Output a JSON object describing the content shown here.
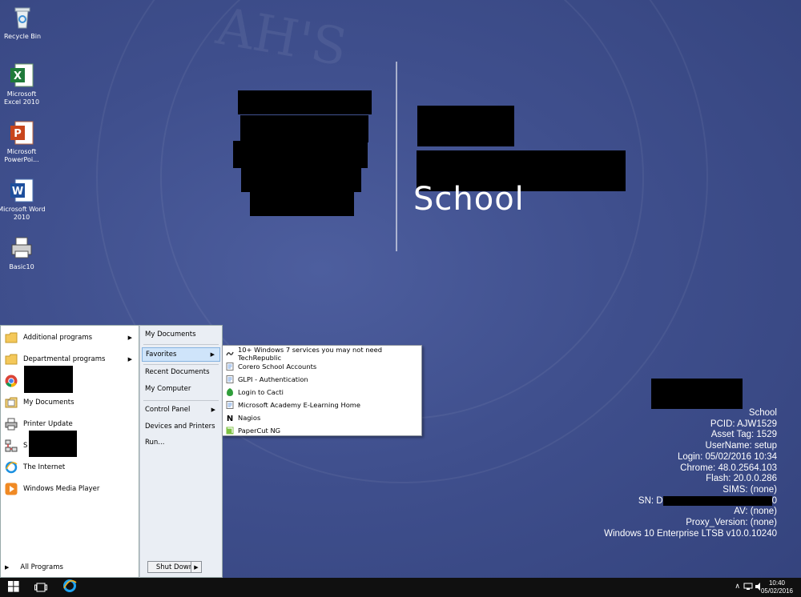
{
  "desktop": {
    "icons": [
      {
        "label": "Recycle Bin"
      },
      {
        "label": "Microsoft Excel 2010"
      },
      {
        "label": "Microsoft PowerPoi..."
      },
      {
        "label": "Microsoft Word 2010"
      },
      {
        "label": "Basic10"
      }
    ]
  },
  "wallpaper": {
    "school_word": "School"
  },
  "start_menu": {
    "left_items": [
      {
        "label": "Additional programs",
        "icon": "folder-icon",
        "has_arrow": true
      },
      {
        "label": "Departmental programs",
        "icon": "folder-icon",
        "has_arrow": true
      },
      {
        "label": "",
        "icon": "chrome-icon",
        "redacted": true
      },
      {
        "label": "My Documents",
        "icon": "documents-icon"
      },
      {
        "label": "Printer Update",
        "icon": "printer-icon"
      },
      {
        "label": "S",
        "icon": "network-icon",
        "redacted": true
      },
      {
        "label": "The Internet",
        "icon": "internet-explorer-icon"
      },
      {
        "label": "Windows Media Player",
        "icon": "media-player-icon"
      }
    ],
    "all_programs": "All Programs",
    "right_items": [
      {
        "label": "My Documents"
      },
      {
        "label": "Favorites",
        "has_arrow": true,
        "highlighted": true
      },
      {
        "label": "Recent Documents"
      },
      {
        "label": "My Computer"
      },
      {
        "label": "Control Panel",
        "has_arrow": true
      },
      {
        "label": "Devices and Printers"
      },
      {
        "label": "Run..."
      }
    ],
    "shutdown_label": "Shut Down"
  },
  "favorites_menu": {
    "items": [
      {
        "label": "10+ Windows 7 services you may not need  TechRepublic",
        "icon": "link-icon"
      },
      {
        "label": "Corero School Accounts",
        "icon": "page-icon"
      },
      {
        "label": "GLPI - Authentication",
        "icon": "page-icon"
      },
      {
        "label": "Login to Cacti",
        "icon": "cacti-icon"
      },
      {
        "label": "Microsoft Academy E-Learning Home",
        "icon": "page-icon"
      },
      {
        "label": "Nagios",
        "icon": "nagios-icon"
      },
      {
        "label": "PaperCut NG",
        "icon": "papercut-icon"
      }
    ]
  },
  "bginfo": {
    "lines": [
      "School",
      "PCID: AJW1529",
      "Asset Tag: 1529",
      "UserName: setup",
      "Login: 05/02/2016 10:34",
      "Chrome: 48.0.2564.103",
      "Flash: 20.0.0.286",
      "SIMS: (none)",
      "SN: D",
      "AV: (none)",
      "Proxy_Version: (none)",
      "Windows 10 Enterprise LTSB v10.0.10240"
    ],
    "sn_suffix": "0"
  },
  "taskbar": {
    "time": "10:40",
    "date": "05/02/2016"
  },
  "colors": {
    "desktop_bg": "#3f4f8d",
    "menu_highlight": "#cfe4fa",
    "taskbar": "#101010"
  }
}
